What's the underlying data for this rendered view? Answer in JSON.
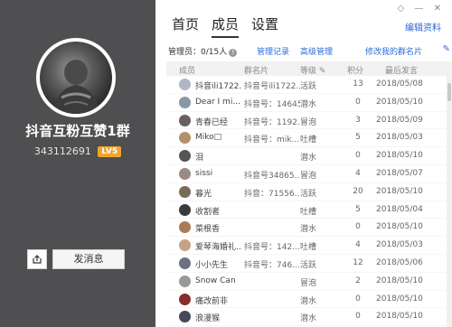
{
  "profile": {
    "group_name": "抖音互粉互赞1群",
    "group_id": "343112691",
    "level_badge": "LV5",
    "send_label": "发消息"
  },
  "tabs": [
    {
      "label": "首页"
    },
    {
      "label": "成员"
    },
    {
      "label": "设置"
    }
  ],
  "header_links": {
    "edit_profile": "编辑资料"
  },
  "toolbar": {
    "member_count": "管理员：0/15人",
    "manage_log": "管理记录",
    "advanced_manage": "高级管理",
    "edit_my_card": "修改我的群名片"
  },
  "table_headers": {
    "member": "成员",
    "card": "群名片",
    "level": "等级",
    "points": "积分",
    "last_msg": "最后发言"
  },
  "members": [
    {
      "name": "抖音ili1722...",
      "card": "抖音号ili1722...",
      "level": "活跃",
      "points": "13",
      "date": "2018/05/08",
      "color": "#b0b8c4"
    },
    {
      "name": "Dear I mi...",
      "card": "抖音号：14645...",
      "level": "潜水",
      "points": "0",
      "date": "2018/05/10",
      "color": "#8b97a6"
    },
    {
      "name": "青春已经",
      "card": "抖音号：1192...",
      "level": "冒泡",
      "points": "3",
      "date": "2018/05/09",
      "color": "#6a6060"
    },
    {
      "name": "Miko□",
      "card": "抖音号：mik...",
      "level": "吐槽",
      "points": "5",
      "date": "2018/05/03",
      "color": "#b38f6e"
    },
    {
      "name": "泪",
      "card": "",
      "level": "潜水",
      "points": "0",
      "date": "2018/05/10",
      "color": "#555555"
    },
    {
      "name": "sissi",
      "card": "抖音号34865...",
      "level": "冒泡",
      "points": "4",
      "date": "2018/05/07",
      "color": "#9c8a86"
    },
    {
      "name": "暮光",
      "card": "抖音：71556...",
      "level": "活跃",
      "points": "20",
      "date": "2018/05/10",
      "color": "#7a6a5a"
    },
    {
      "name": "收割者",
      "card": "",
      "level": "吐槽",
      "points": "5",
      "date": "2018/05/04",
      "color": "#3a3a3a"
    },
    {
      "name": "菜根香",
      "card": "",
      "level": "潜水",
      "points": "0",
      "date": "2018/05/10",
      "color": "#a97b56"
    },
    {
      "name": "爱琴海婚礼...",
      "card": "抖音号：142...",
      "level": "吐槽",
      "points": "4",
      "date": "2018/05/03",
      "color": "#c7a184"
    },
    {
      "name": "小小先生",
      "card": "抖音号：746...",
      "level": "活跃",
      "points": "12",
      "date": "2018/05/06",
      "color": "#6d7280"
    },
    {
      "name": "Snow Can",
      "card": "",
      "level": "冒泡",
      "points": "2",
      "date": "2018/05/10",
      "color": "#999999"
    },
    {
      "name": "痛改前非",
      "card": "",
      "level": "潜水",
      "points": "0",
      "date": "2018/05/10",
      "color": "#8a2c2c"
    },
    {
      "name": "浪漫猴",
      "card": "",
      "level": "潜水",
      "points": "0",
      "date": "2018/05/10",
      "color": "#47485a"
    }
  ]
}
